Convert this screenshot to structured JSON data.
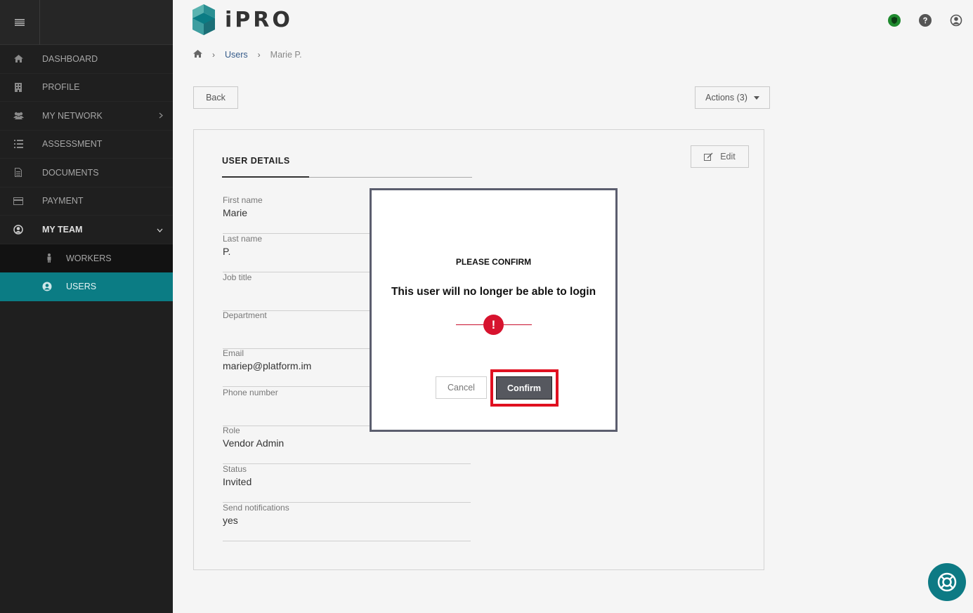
{
  "app": {
    "logo_text": "iPRO"
  },
  "sidebar": {
    "items": [
      {
        "label": "DASHBOARD",
        "icon": "home-icon"
      },
      {
        "label": "PROFILE",
        "icon": "building-icon"
      },
      {
        "label": "MY NETWORK",
        "icon": "users-icon"
      },
      {
        "label": "ASSESSMENT",
        "icon": "list-icon"
      },
      {
        "label": "DOCUMENTS",
        "icon": "document-icon"
      },
      {
        "label": "PAYMENT",
        "icon": "credit-card-icon"
      },
      {
        "label": "MY TEAM",
        "icon": "user-circle-icon"
      }
    ],
    "subitems": [
      {
        "label": "WORKERS",
        "icon": "person-icon"
      },
      {
        "label": "USERS",
        "icon": "user-circle-icon"
      }
    ]
  },
  "breadcrumb": {
    "users": "Users",
    "current": "Marie P."
  },
  "toolbar": {
    "back_label": "Back",
    "actions_label": "Actions (3)"
  },
  "card": {
    "tab_title": "USER DETAILS",
    "edit_label": "Edit",
    "fields": [
      {
        "label": "First name",
        "value": "Marie"
      },
      {
        "label": "Last name",
        "value": "P."
      },
      {
        "label": "Job title",
        "value": ""
      },
      {
        "label": "Department",
        "value": ""
      },
      {
        "label": "Email",
        "value": "mariep@platform.im"
      },
      {
        "label": "Phone number",
        "value": ""
      },
      {
        "label": "Role",
        "value": "Vendor Admin"
      },
      {
        "label": "Status",
        "value": "Invited"
      },
      {
        "label": "Send notifications",
        "value": "yes"
      }
    ]
  },
  "dialog": {
    "title": "PLEASE CONFIRM",
    "message": "This user will no longer be able to login",
    "warning_glyph": "!",
    "cancel_label": "Cancel",
    "confirm_label": "Confirm"
  },
  "colors": {
    "accent": "#0b7c84",
    "warning": "#d7132e",
    "highlight": "#e01020"
  }
}
